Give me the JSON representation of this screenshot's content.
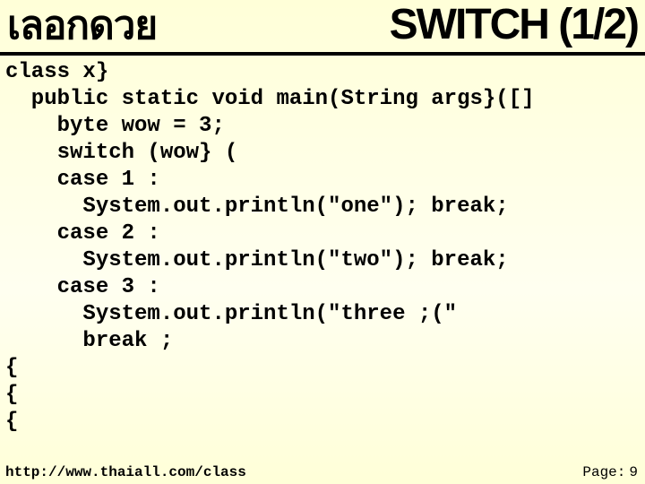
{
  "header": {
    "title_left": "เลอกดวย",
    "title_right": "SWITCH (1/2)"
  },
  "code": {
    "lines": [
      "class x}",
      "  public static void main(String args}([]",
      "    byte wow = 3;",
      "    switch (wow} (",
      "    case 1 :",
      "      System.out.println(\"one\"); break;",
      "    case 2 :",
      "      System.out.println(\"two\"); break;",
      "    case 3 :",
      "      System.out.println(\"three ;(\"",
      "      break ;",
      "{",
      "{",
      "{"
    ]
  },
  "footer": {
    "url": "http://www.thaiall.com/class",
    "page_label": "Page:",
    "page_number": "9"
  }
}
